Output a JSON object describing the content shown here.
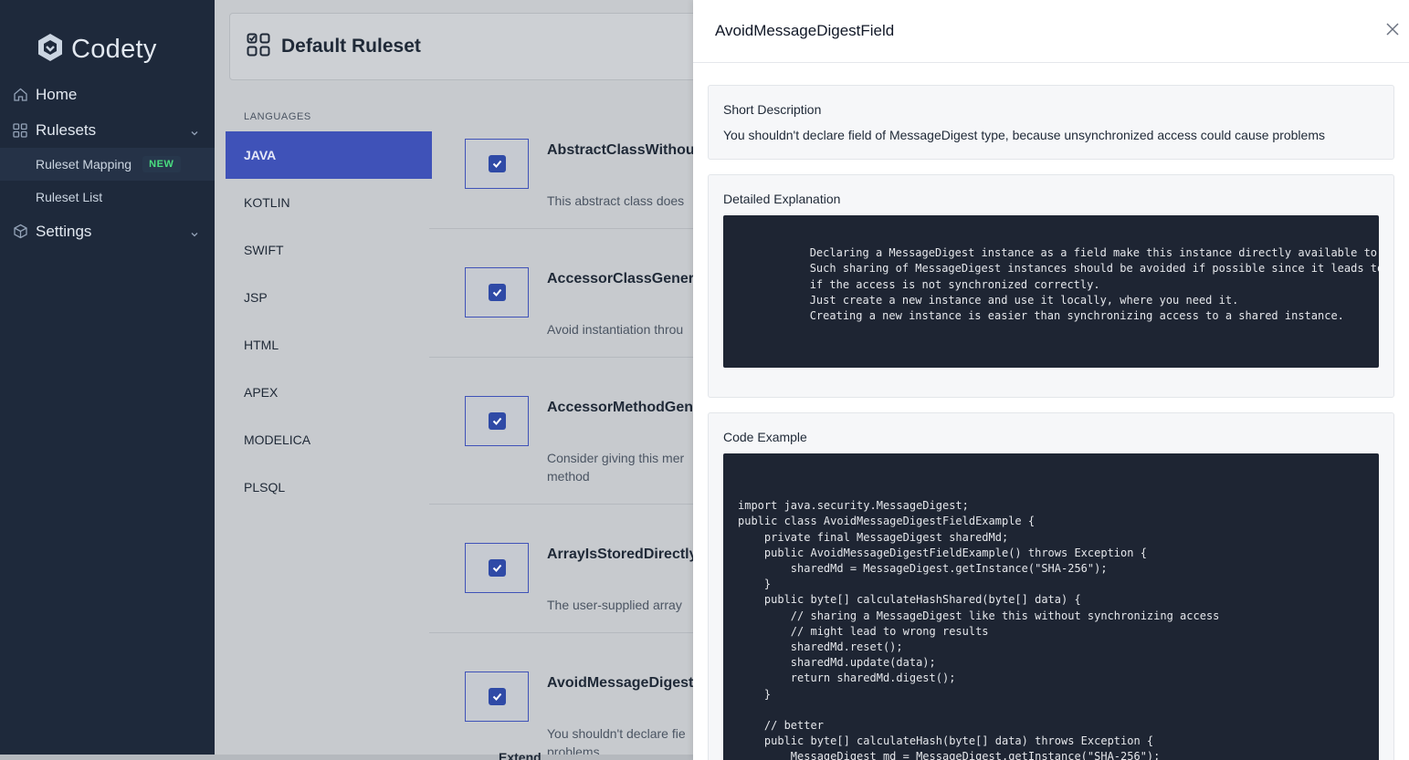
{
  "app": {
    "name": "Codety"
  },
  "sidebar": {
    "items": [
      {
        "label": "Home"
      },
      {
        "label": "Rulesets"
      },
      {
        "label": "Settings"
      }
    ],
    "sub_items": [
      {
        "label": "Ruleset Mapping",
        "badge": "NEW"
      },
      {
        "label": "Ruleset List"
      }
    ]
  },
  "page": {
    "title": "Default Ruleset",
    "languages_label": "LANGUAGES",
    "languages": [
      "JAVA",
      "KOTLIN",
      "SWIFT",
      "JSP",
      "HTML",
      "APEX",
      "MODELICA",
      "PLSQL"
    ],
    "active_language": "JAVA",
    "rules": [
      {
        "name": "AbstractClassWithou",
        "desc": "This abstract class does"
      },
      {
        "name": "AccessorClassGener",
        "desc": "Avoid instantiation throu"
      },
      {
        "name": "AccessorMethodGen",
        "desc": "Consider giving this mer",
        "desc2": "method"
      },
      {
        "name": "ArrayIsStoredDirectly",
        "desc": "The user-supplied array"
      },
      {
        "name": "AvoidMessageDigest",
        "desc": "You shouldn't declare fie",
        "desc2": "problems"
      }
    ],
    "footer_fragment": "Extend"
  },
  "drawer": {
    "title": "AvoidMessageDigestField",
    "short_description": {
      "heading": "Short Description",
      "text": "You shouldn't declare field of MessageDigest type, because unsynchronized access could cause problems"
    },
    "detailed_explanation": {
      "heading": "Detailed Explanation",
      "code": "\n            Declaring a MessageDigest instance as a field make this instance directly available to multiple threads.\n            Such sharing of MessageDigest instances should be avoided if possible since it leads to wrong results\n            if the access is not synchronized correctly.\n            Just create a new instance and use it locally, where you need it.\n            Creating a new instance is easier than synchronizing access to a shared instance.\n"
    },
    "code_example": {
      "heading": "Code Example",
      "code": "\nimport java.security.MessageDigest;\npublic class AvoidMessageDigestFieldExample {\n    private final MessageDigest sharedMd;\n    public AvoidMessageDigestFieldExample() throws Exception {\n        sharedMd = MessageDigest.getInstance(\"SHA-256\");\n    }\n    public byte[] calculateHashShared(byte[] data) {\n        // sharing a MessageDigest like this without synchronizing access\n        // might lead to wrong results\n        sharedMd.reset();\n        sharedMd.update(data);\n        return sharedMd.digest();\n    }\n\n    // better\n    public byte[] calculateHash(byte[] data) throws Exception {\n        MessageDigest md = MessageDigest.getInstance(\"SHA-256\");"
    }
  },
  "colors": {
    "sidebar_bg": "#1e293b",
    "accent": "#3f52b8",
    "badge_green": "#4ade80",
    "code_bg": "#1e2533"
  }
}
